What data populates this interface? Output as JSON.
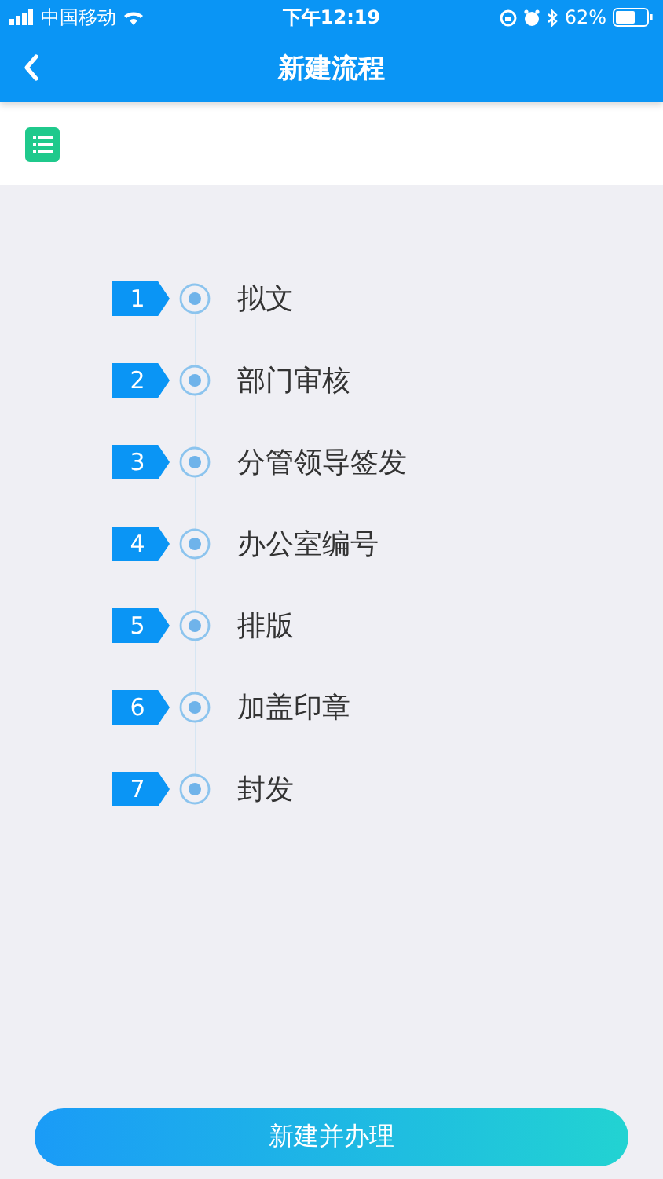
{
  "status_bar": {
    "carrier": "中国移动",
    "time": "下午12:19",
    "battery": "62%"
  },
  "nav": {
    "title": "新建流程"
  },
  "steps": [
    {
      "number": "1",
      "label": "拟文"
    },
    {
      "number": "2",
      "label": "部门审核"
    },
    {
      "number": "3",
      "label": "分管领导签发"
    },
    {
      "number": "4",
      "label": "办公室编号"
    },
    {
      "number": "5",
      "label": "排版"
    },
    {
      "number": "6",
      "label": "加盖印章"
    },
    {
      "number": "7",
      "label": "封发"
    }
  ],
  "action_button": {
    "label": "新建并办理"
  }
}
